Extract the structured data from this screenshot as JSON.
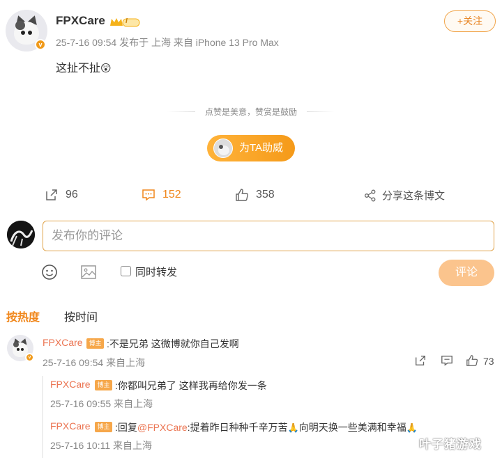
{
  "post": {
    "username": "FPXCare",
    "level_badge": "I",
    "meta": "25-7-16 09:54 发布于 上海 来自 iPhone 13 Pro Max",
    "text": "这扯不扯",
    "text_emoji": "😲",
    "follow_label": "+关注"
  },
  "reward": {
    "divider_text": "点赞是美意，赞赏是鼓励",
    "boost_label": "为TA助威"
  },
  "actions": {
    "repost_count": "96",
    "comment_count": "152",
    "like_count": "358",
    "share_label": "分享这条博文"
  },
  "composer": {
    "placeholder": "发布你的评论",
    "repost_label": "同时转发",
    "submit_label": "评论"
  },
  "sort": {
    "hot": "按热度",
    "time": "按时间"
  },
  "comments": [
    {
      "name": "FPXCare",
      "tag": "博主",
      "text": ":不是兄弟 这微博就你自己发啊",
      "meta": "25-7-16 09:54 来自上海",
      "likes": "73"
    }
  ],
  "replies": [
    {
      "name": "FPXCare",
      "tag": "博主",
      "text": ":你都叫兄弟了 这样我再给你发一条",
      "meta": "25-7-16 09:55 来自上海"
    },
    {
      "name": "FPXCare",
      "tag": "博主",
      "text_prefix": ":回复",
      "mention": "@FPXCare",
      "text_body": ":提着昨日种种千辛万苦",
      "text_middle": "向明天换一些美满和幸福",
      "emoji": "🙏",
      "meta": "25-7-16 10:11 来自上海"
    }
  ],
  "watermark": "叶子猪游戏",
  "colors": {
    "accent": "#f0861a",
    "name_link": "#eb7350",
    "submit_disabled": "#fbc48d"
  }
}
